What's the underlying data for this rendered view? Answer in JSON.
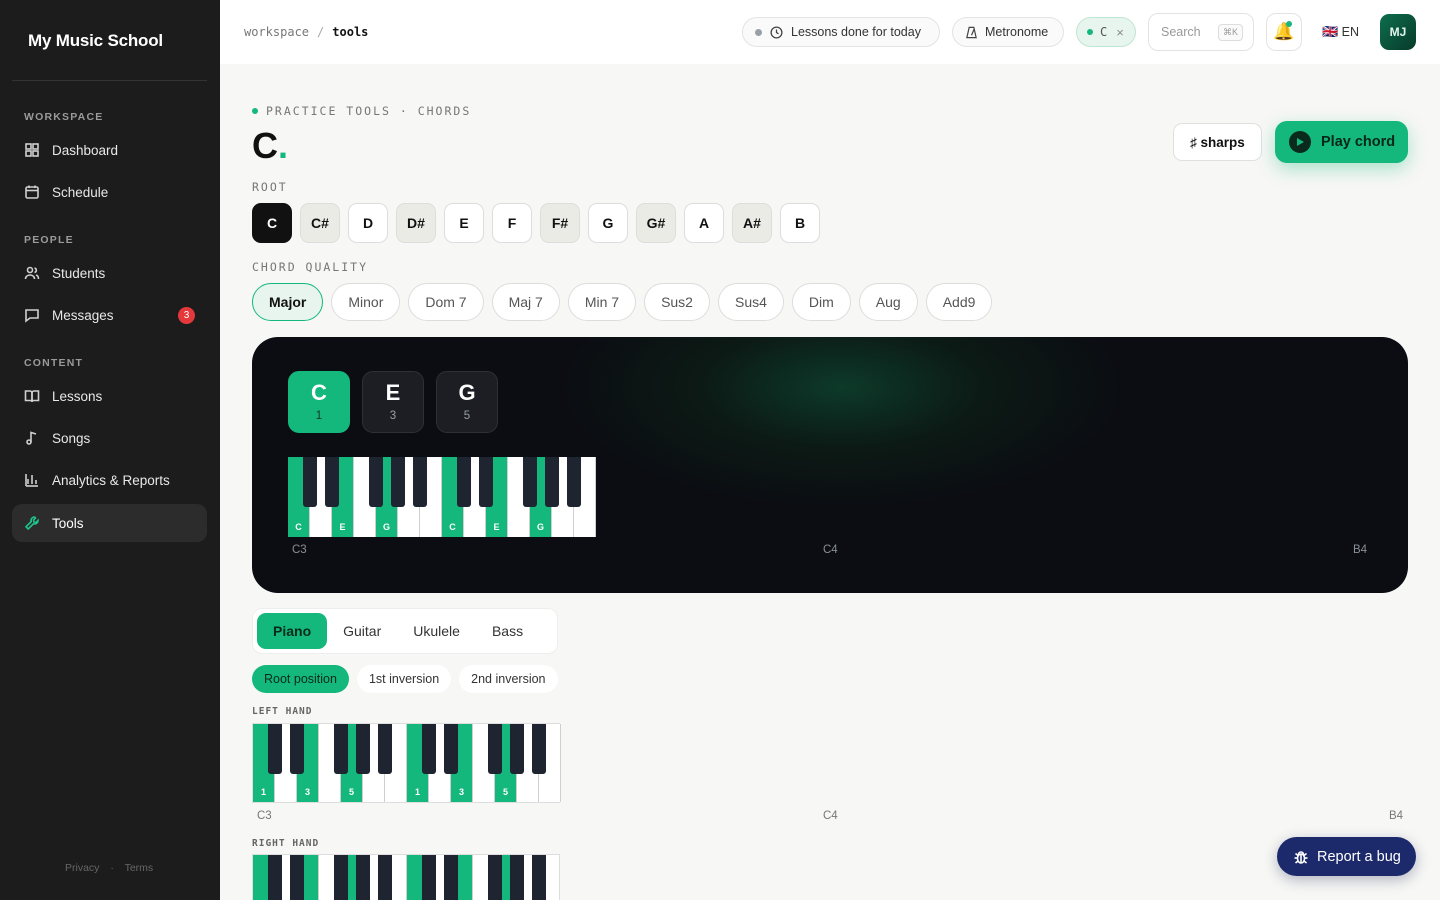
{
  "sidebar": {
    "brand": "My Music School",
    "sections": [
      "WORKSPACE",
      "PEOPLE",
      "CONTENT"
    ],
    "items": [
      {
        "label": "Dashboard",
        "icon": "grid-icon"
      },
      {
        "label": "Schedule",
        "icon": "calendar-icon"
      },
      {
        "label": "Students",
        "icon": "users-icon"
      },
      {
        "label": "Messages",
        "icon": "message-icon",
        "badge": "3"
      },
      {
        "label": "Lessons",
        "icon": "book-icon"
      },
      {
        "label": "Songs",
        "icon": "music-note-icon"
      },
      {
        "label": "Analytics & Reports",
        "icon": "bar-chart-icon"
      },
      {
        "label": "Tools",
        "icon": "wrench-icon",
        "active": true
      }
    ],
    "footer": {
      "privacy": "Privacy",
      "sep": "·",
      "terms": "Terms"
    }
  },
  "topbar": {
    "breadcrumb": {
      "root": "workspace",
      "sep": "/",
      "current": "tools"
    },
    "lessons_pill": "Lessons done for today",
    "metronome": "Metronome",
    "chip": {
      "label": "C",
      "close": "×"
    },
    "search": {
      "placeholder": "Search",
      "shortcut": "⌘K"
    },
    "lang": "EN",
    "lang_flag": "🇬🇧",
    "avatar_initials": "MJ"
  },
  "main": {
    "eyebrow": "PRACTICE TOOLS · CHORDS",
    "chord_name": "C",
    "chord_dot": ".",
    "sharps_button": "♯ sharps",
    "play_button": "Play chord",
    "root_label": "ROOT",
    "roots": [
      "C",
      "C#",
      "D",
      "D#",
      "E",
      "F",
      "F#",
      "G",
      "G#",
      "A",
      "A#",
      "B"
    ],
    "selected_root": "C",
    "quality_label": "CHORD QUALITY",
    "qualities": [
      "Major",
      "Minor",
      "Dom 7",
      "Maj 7",
      "Min 7",
      "Sus2",
      "Sus4",
      "Dim",
      "Aug",
      "Add9"
    ],
    "selected_quality": "Major",
    "chord_notes": [
      {
        "name": "C",
        "degree": "1"
      },
      {
        "name": "E",
        "degree": "3"
      },
      {
        "name": "G",
        "degree": "5"
      }
    ],
    "keyboard": {
      "range_labels": [
        "C3",
        "C4",
        "B4"
      ],
      "highlight_white": [
        {
          "index": 0,
          "label": "C"
        },
        {
          "index": 2,
          "label": "E"
        },
        {
          "index": 4,
          "label": "G"
        },
        {
          "index": 7,
          "label": "C"
        },
        {
          "index": 9,
          "label": "E"
        },
        {
          "index": 11,
          "label": "G"
        }
      ]
    },
    "instruments": [
      "Piano",
      "Guitar",
      "Ukulele",
      "Bass"
    ],
    "selected_instrument": "Piano",
    "inversions": [
      "Root position",
      "1st inversion",
      "2nd inversion"
    ],
    "selected_inversion": "Root position",
    "left_hand_label": "LEFT HAND",
    "right_hand_label": "RIGHT HAND",
    "hand_keyboard": {
      "range_labels": [
        "C3",
        "C4",
        "B4"
      ],
      "highlight_white": [
        {
          "index": 0,
          "label": "1"
        },
        {
          "index": 2,
          "label": "3"
        },
        {
          "index": 4,
          "label": "5"
        },
        {
          "index": 7,
          "label": "1"
        },
        {
          "index": 9,
          "label": "3"
        },
        {
          "index": 11,
          "label": "5"
        }
      ]
    }
  },
  "report_bug": "Report a bug",
  "colors": {
    "accent": "#14b87c",
    "sidebar_bg": "#1c1c1c",
    "dark_panel": "#0b0d12",
    "report_btn": "#1c2a6b"
  }
}
